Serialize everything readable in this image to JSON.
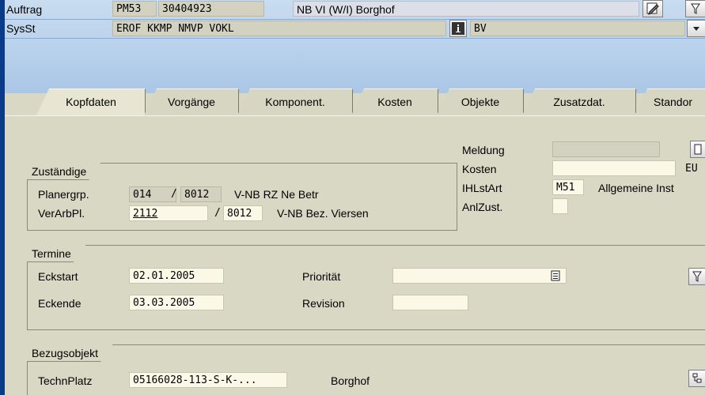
{
  "header": {
    "auftrag_label": "Auftrag",
    "order_type": "PM53",
    "order_number": "30404923",
    "order_description": "NB VI (W/I) Borghof",
    "sysst_label": "SysSt",
    "system_status": "EROF KKMP NMVP VOKL",
    "user_status": "BV"
  },
  "tabs": [
    {
      "label": "Kopfdaten",
      "active": true
    },
    {
      "label": "Vorgänge"
    },
    {
      "label": "Komponent."
    },
    {
      "label": "Kosten"
    },
    {
      "label": "Objekte"
    },
    {
      "label": "Zusatzdat."
    },
    {
      "label": "Standor"
    }
  ],
  "zustaendige": {
    "title": "Zuständige",
    "planergrp_label": "Planergrp.",
    "planergrp_value": "014",
    "slash1": "/",
    "planergrp_plant": "8012",
    "planergrp_text": "V-NB RZ Ne Betr",
    "verarbpl_label": "VerArbPl.",
    "verarbpl_value": "2112",
    "slash2": "/",
    "verarbpl_plant": "8012",
    "verarbpl_text": "V-NB Bez. Viersen"
  },
  "right_panel": {
    "meldung_label": "Meldung",
    "meldung_value": "",
    "kosten_label": "Kosten",
    "kosten_value": "",
    "kosten_currency": "EU",
    "ihlstart_label": "IHLstArt",
    "ihlstart_value": "M51",
    "ihlstart_text": "Allgemeine Inst",
    "anlzust_label": "AnlZust.",
    "anlzust_value": ""
  },
  "termine": {
    "title": "Termine",
    "eckstart_label": "Eckstart",
    "eckstart_value": "02.01.2005",
    "eckende_label": "Eckende",
    "eckende_value": "03.03.2005",
    "prioritaet_label": "Priorität",
    "prioritaet_value": "",
    "revision_label": "Revision",
    "revision_value": ""
  },
  "bezugsobjekt": {
    "title": "Bezugsobjekt",
    "technplatz_label": "TechnPlatz",
    "technplatz_value": "05166028-113-S-K-...",
    "technplatz_text": "Borghof"
  },
  "icons": {
    "edit": "pencil-icon",
    "info": "info-icon",
    "filter": "filter-icon",
    "dropdown": "dropdown-icon",
    "hierarchy": "hierarchy-icon"
  }
}
